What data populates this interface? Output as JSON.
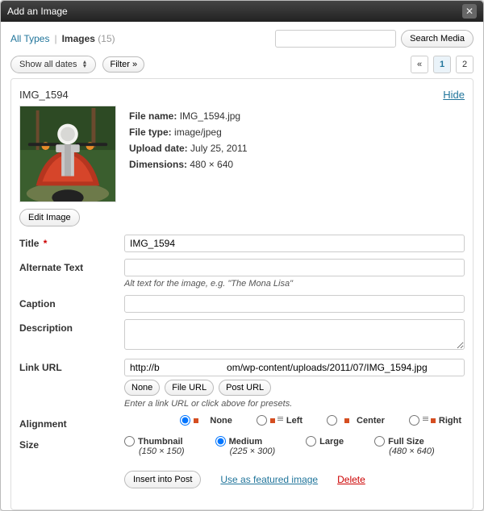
{
  "dialog": {
    "title": "Add an Image"
  },
  "tabs": {
    "all_types": "All Types",
    "images": "Images",
    "count": "(15)"
  },
  "search": {
    "button": "Search Media"
  },
  "filter": {
    "dates": "Show all dates",
    "filter_btn": "Filter »"
  },
  "pager": {
    "prev": "«",
    "p1": "1",
    "p2": "2"
  },
  "item": {
    "name": "IMG_1594",
    "hide": "Hide",
    "filename_label": "File name:",
    "filename": "IMG_1594.jpg",
    "filetype_label": "File type:",
    "filetype": "image/jpeg",
    "upload_label": "Upload date:",
    "upload": "July 25, 2011",
    "dim_label": "Dimensions:",
    "dim": "480 × 640",
    "edit_image": "Edit Image"
  },
  "fields": {
    "title_label": "Title",
    "title_value": "IMG_1594",
    "alt_label": "Alternate Text",
    "alt_hint": "Alt text for the image, e.g. \"The Mona Lisa\"",
    "caption_label": "Caption",
    "desc_label": "Description",
    "linkurl_label": "Link URL",
    "linkurl_value": "http://b                         om/wp-content/uploads/2011/07/IMG_1594.jpg",
    "linkurl_none": "None",
    "linkurl_file": "File URL",
    "linkurl_post": "Post URL",
    "linkurl_hint": "Enter a link URL or click above for presets.",
    "align_label": "Alignment",
    "align_none": "None",
    "align_left": "Left",
    "align_center": "Center",
    "align_right": "Right",
    "size_label": "Size",
    "size_thumb": "Thumbnail",
    "size_thumb_dim": "(150 × 150)",
    "size_med": "Medium",
    "size_med_dim": "(225 × 300)",
    "size_large": "Large",
    "size_full": "Full Size",
    "size_full_dim": "(480 × 640)"
  },
  "actions": {
    "insert": "Insert into Post",
    "featured": "Use as featured image",
    "delete": "Delete"
  }
}
